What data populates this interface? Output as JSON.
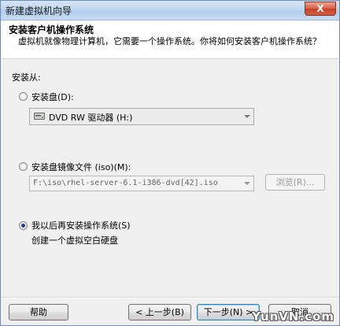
{
  "window": {
    "title": "新建虚拟机向导",
    "close_label": "X"
  },
  "header": {
    "title": "安装客户机操作系统",
    "description": "虚拟机就像物理计算机，它需要一个操作系统。你将如何安装客户机操作系统？"
  },
  "install_from": {
    "label": "安装从:",
    "option_disc": {
      "label": "安装盘(D):",
      "selected": false
    },
    "disc_value": "DVD RW 驱动器 (H:)",
    "option_iso": {
      "label": "安装盘镜像文件 (iso)(M):",
      "selected": false
    },
    "iso_path": "F:\\iso\\rhel-server-6.1-i386-dvd[42].iso",
    "browse_label": "浏览(R)...",
    "option_later": {
      "label": "我以后再安装操作系统(S)",
      "selected": true
    },
    "later_desc": "创建一个虚拟空白硬盘"
  },
  "footer": {
    "help_label": "帮助",
    "back_label": "< 上一步(B)",
    "next_label": "下一步(N) >",
    "cancel_label": "取消"
  },
  "watermark": "YunVN.com",
  "icons": {
    "close": "close-icon",
    "drive": "dvd-drive-icon",
    "dropdown": "chevron-down-icon"
  },
  "colors": {
    "title_bar": "#c0d6f1",
    "close_button": "#c7402a",
    "radio_selected": "#1f3f88"
  }
}
